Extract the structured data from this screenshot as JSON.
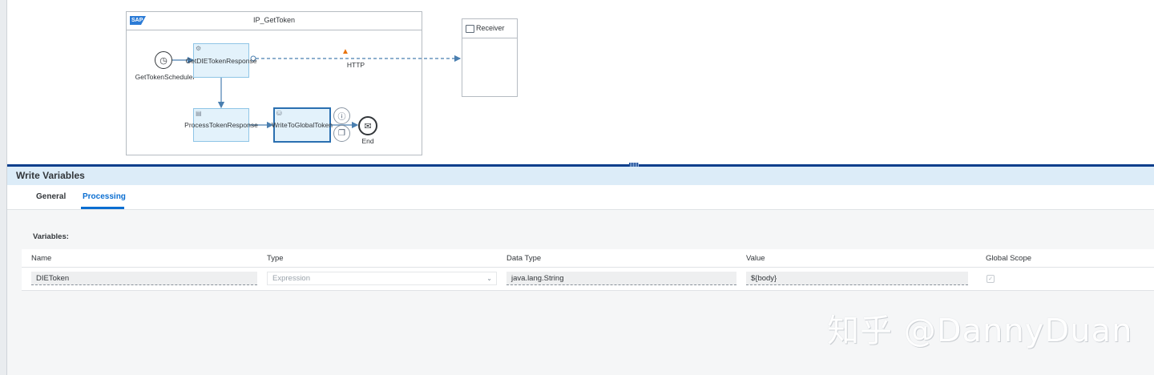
{
  "diagram": {
    "pool_title": "IP_GetToken",
    "sap_logo_text": "SAP",
    "receiver_label": "Receiver",
    "start_event_label": "GetTokenScheduler",
    "steps": {
      "get_response": "GetDIETokenResponse",
      "process_response": "ProcessTokenResponse",
      "write_global": "WriteToGlobalToken"
    },
    "end_event_label": "End",
    "connection_label": "HTTP"
  },
  "panel": {
    "title": "Write Variables",
    "tabs": [
      {
        "label": "General"
      },
      {
        "label": "Processing"
      }
    ],
    "active_tab": "Processing",
    "variables_label": "Variables:",
    "columns": [
      "Name",
      "Type",
      "Data Type",
      "Value",
      "Global Scope"
    ],
    "rows": [
      {
        "name": "DIEToken",
        "type": "Expression",
        "data_type": "java.lang.String",
        "value": "${body}",
        "global_scope": true
      }
    ]
  },
  "watermark": "知乎 @DannyDuan",
  "colors": {
    "accent": "#0a6ed1",
    "splitter": "#0a3e8c",
    "step_fill": "#e3f2fb",
    "panel_header": "#dcecf8",
    "warning": "#e9730c"
  }
}
